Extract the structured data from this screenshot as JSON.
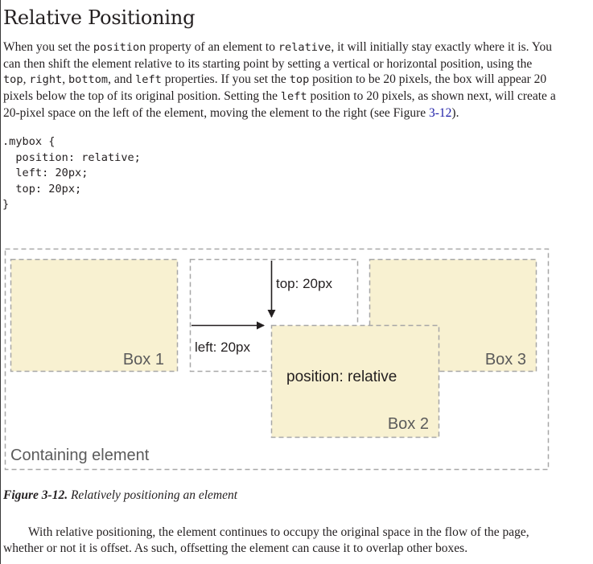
{
  "heading": "Relative Positioning",
  "intro": {
    "l1a": "When you set the ",
    "l1b": "position",
    "l1c": " property of an element to ",
    "l1d": "relative",
    "l1e": ", it will initially stay exactly where it is. You",
    "l2": "can then shift the element relative to its starting point by setting a vertical or horizontal position, using the",
    "l3a": "top",
    "l3b": ", ",
    "l3c": "right",
    "l3d": ", ",
    "l3e": "bottom",
    "l3f": ", and ",
    "l3g": "left",
    "l3h": " properties. If you set the ",
    "l3i": "top",
    "l3j": " position to be 20 pixels, the box will appear 20",
    "l4a": "pixels below the top of its original position. Setting the ",
    "l4b": "left",
    "l4c": " position to 20 pixels, as shown next, will create a",
    "l5a": "20-pixel space on the left of the element, moving the element to the right (see Figure ",
    "l5b": "3-12",
    "l5c": ")."
  },
  "code": [
    ".mybox {",
    "  position: relative;",
    "  left: 20px;",
    "  top: 20px;",
    "}"
  ],
  "figure": {
    "box1": "Box 1",
    "box2": "Box 2",
    "box3": "Box 3",
    "box2_text": "position: relative",
    "top_label": "top: 20px",
    "left_label": "left: 20px",
    "container_label": "Containing element",
    "colors": {
      "box_fill": "#f8f1d1",
      "dash": "#a7a7a7",
      "label": "#5b5b5b",
      "arrow": "#231f20"
    }
  },
  "caption": {
    "number": "Figure 3-12.",
    "text": "  Relatively positioning an element"
  },
  "closing": {
    "l1": "With relative positioning, the element continues to occupy the original space in the flow of the page,",
    "l2": "whether or not it is offset. As such, offsetting the element can cause it to overlap other boxes."
  }
}
